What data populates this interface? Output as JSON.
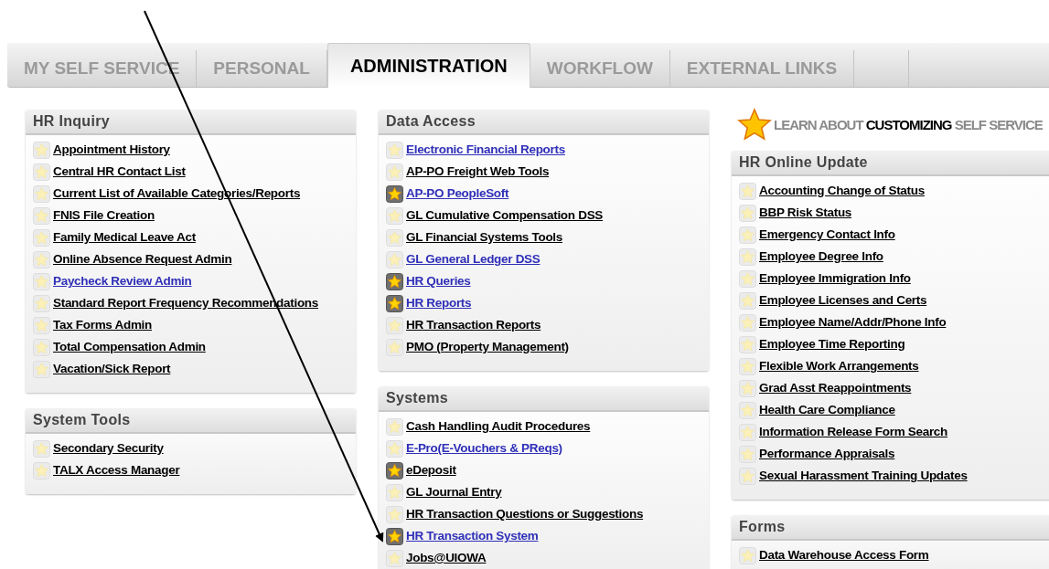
{
  "tabs": [
    {
      "label": "MY SELF SERVICE",
      "selected": false
    },
    {
      "label": "PERSONAL",
      "selected": false
    },
    {
      "label": "ADMINISTRATION",
      "selected": true
    },
    {
      "label": "WORKFLOW",
      "selected": false
    },
    {
      "label": "EXTERNAL LINKS",
      "selected": false
    }
  ],
  "banner": {
    "text": "LEARN ABOUT **CUSTOMIZING** SELF SERVICE"
  },
  "columns": [
    {
      "panels": [
        {
          "title": "HR Inquiry",
          "items": [
            {
              "label": "Appointment History",
              "visited": true,
              "favorite": false
            },
            {
              "label": "Central HR Contact List",
              "visited": true,
              "favorite": false
            },
            {
              "label": "Current List of Available Categories/Reports",
              "visited": true,
              "favorite": false
            },
            {
              "label": "FNIS File Creation",
              "visited": true,
              "favorite": false
            },
            {
              "label": "Family Medical Leave Act",
              "visited": true,
              "favorite": false
            },
            {
              "label": "Online Absence Request Admin",
              "visited": true,
              "favorite": false
            },
            {
              "label": "Paycheck Review Admin",
              "visited": false,
              "favorite": false
            },
            {
              "label": "Standard Report Frequency Recommendations",
              "visited": true,
              "favorite": false
            },
            {
              "label": "Tax Forms Admin",
              "visited": true,
              "favorite": false
            },
            {
              "label": "Total Compensation Admin",
              "visited": true,
              "favorite": false
            },
            {
              "label": "Vacation/Sick Report",
              "visited": true,
              "favorite": false
            }
          ]
        },
        {
          "title": "System Tools",
          "items": [
            {
              "label": "Secondary Security",
              "visited": true,
              "favorite": false
            },
            {
              "label": "TALX Access Manager",
              "visited": true,
              "favorite": false
            }
          ]
        }
      ]
    },
    {
      "panels": [
        {
          "title": "Data Access",
          "items": [
            {
              "label": "Electronic Financial Reports",
              "visited": false,
              "favorite": false
            },
            {
              "label": "AP-PO Freight Web Tools",
              "visited": true,
              "favorite": false
            },
            {
              "label": "AP-PO PeopleSoft",
              "visited": false,
              "favorite": true
            },
            {
              "label": "GL Cumulative Compensation DSS",
              "visited": true,
              "favorite": false
            },
            {
              "label": "GL Financial Systems Tools",
              "visited": true,
              "favorite": false
            },
            {
              "label": "GL General Ledger DSS",
              "visited": false,
              "favorite": false
            },
            {
              "label": "HR Queries",
              "visited": false,
              "favorite": true
            },
            {
              "label": "HR Reports",
              "visited": false,
              "favorite": true
            },
            {
              "label": "HR Transaction Reports",
              "visited": true,
              "favorite": false
            },
            {
              "label": "PMO (Property Management)",
              "visited": true,
              "favorite": false
            }
          ]
        },
        {
          "title": "Systems",
          "items": [
            {
              "label": "Cash Handling Audit Procedures",
              "visited": true,
              "favorite": false
            },
            {
              "label": "E-Pro(E-Vouchers & PReqs)",
              "visited": false,
              "favorite": false
            },
            {
              "label": "eDeposit",
              "visited": true,
              "favorite": true
            },
            {
              "label": "GL Journal Entry",
              "visited": true,
              "favorite": false
            },
            {
              "label": "HR Transaction Questions or Suggestions",
              "visited": true,
              "favorite": false
            },
            {
              "label": "HR Transaction System",
              "visited": false,
              "favorite": true
            },
            {
              "label": "Jobs@UIOWA",
              "visited": true,
              "favorite": false
            }
          ]
        }
      ]
    },
    {
      "panels": [
        {
          "title": "HR Online Update",
          "items": [
            {
              "label": "Accounting Change of Status",
              "visited": true,
              "favorite": false
            },
            {
              "label": "BBP Risk Status",
              "visited": true,
              "favorite": false
            },
            {
              "label": "Emergency Contact Info",
              "visited": true,
              "favorite": false
            },
            {
              "label": "Employee Degree Info",
              "visited": true,
              "favorite": false
            },
            {
              "label": "Employee Immigration Info",
              "visited": true,
              "favorite": false
            },
            {
              "label": "Employee Licenses and Certs",
              "visited": true,
              "favorite": false
            },
            {
              "label": "Employee Name/Addr/Phone Info",
              "visited": true,
              "favorite": false
            },
            {
              "label": "Employee Time Reporting",
              "visited": true,
              "favorite": false
            },
            {
              "label": "Flexible Work Arrangements",
              "visited": true,
              "favorite": false
            },
            {
              "label": "Grad Asst Reappointments",
              "visited": true,
              "favorite": false
            },
            {
              "label": "Health Care Compliance",
              "visited": true,
              "favorite": false
            },
            {
              "label": "Information Release Form Search",
              "visited": true,
              "favorite": false
            },
            {
              "label": "Performance Appraisals",
              "visited": true,
              "favorite": false
            },
            {
              "label": "Sexual Harassment Training Updates",
              "visited": true,
              "favorite": false
            }
          ]
        },
        {
          "title": "Forms",
          "items": [
            {
              "label": "Data Warehouse Access Form",
              "visited": true,
              "favorite": false
            }
          ]
        }
      ]
    }
  ]
}
